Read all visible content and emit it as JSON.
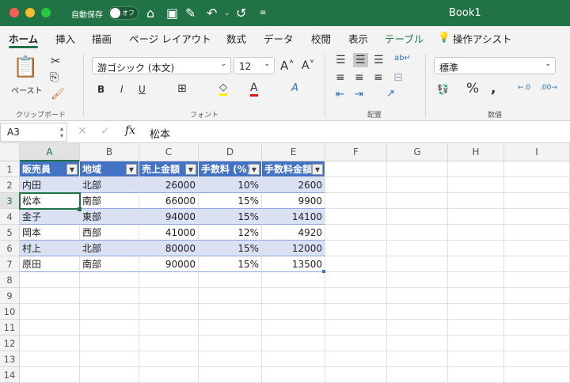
{
  "titlebar": {
    "autosave_label": "自動保存",
    "autosave_state": "オフ",
    "title": "Book1"
  },
  "tabs": [
    "ホーム",
    "挿入",
    "描画",
    "ページ レイアウト",
    "数式",
    "データ",
    "校閲",
    "表示",
    "テーブル",
    "操作アシスト"
  ],
  "ribbon": {
    "paste_label": "ペースト",
    "clipboard_group": "クリップボード",
    "font_name": "游ゴシック (本文)",
    "font_size": "12",
    "font_group": "フォント",
    "bold": "B",
    "italic": "I",
    "underline": "U",
    "align_group": "配置",
    "number_format": "標準",
    "number_group": "数値"
  },
  "formula_bar": {
    "name_box": "A3",
    "fx": "fx",
    "value": "松本"
  },
  "columns": [
    "A",
    "B",
    "C",
    "D",
    "E",
    "F",
    "G",
    "H",
    "I"
  ],
  "rows": [
    "1",
    "2",
    "3",
    "4",
    "5",
    "6",
    "7",
    "8",
    "9",
    "10",
    "11",
    "12",
    "13",
    "14"
  ],
  "table": {
    "headers": [
      "販売員",
      "地域",
      "売上金額",
      "手数料 (%)",
      "手数料金額"
    ],
    "rows": [
      [
        "内田",
        "北部",
        "26000",
        "10%",
        "2600"
      ],
      [
        "松本",
        "南部",
        "66000",
        "15%",
        "9900"
      ],
      [
        "金子",
        "東部",
        "94000",
        "15%",
        "14100"
      ],
      [
        "岡本",
        "西部",
        "41000",
        "12%",
        "4920"
      ],
      [
        "村上",
        "北部",
        "80000",
        "15%",
        "12000"
      ],
      [
        "原田",
        "南部",
        "90000",
        "15%",
        "13500"
      ]
    ]
  },
  "colors": {
    "brand": "#217346",
    "table_header": "#4472c4",
    "band": "#d9e1f2"
  }
}
